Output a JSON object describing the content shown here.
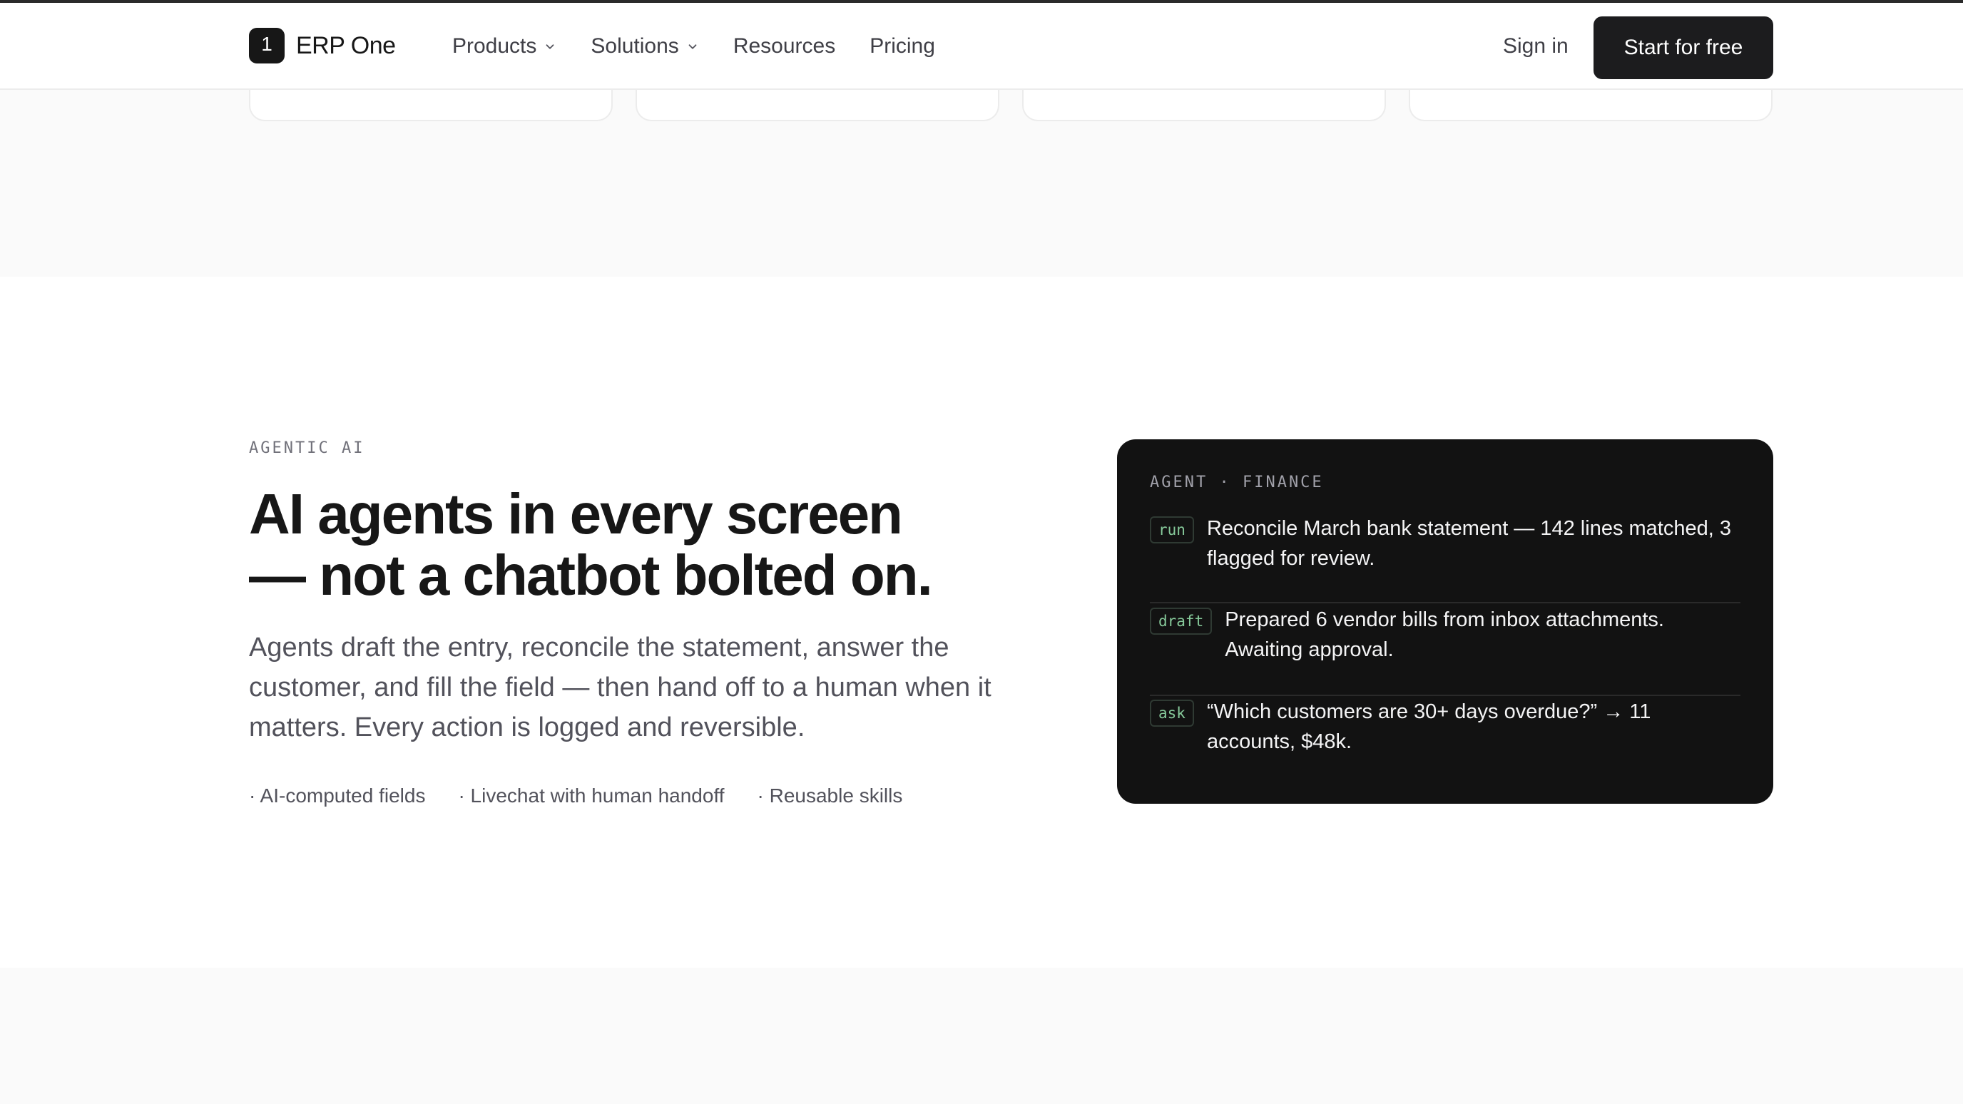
{
  "header": {
    "logo_mark": "1",
    "logo_text": "ERP One",
    "nav": [
      {
        "label": "Products",
        "has_dropdown": true
      },
      {
        "label": "Solutions",
        "has_dropdown": true
      },
      {
        "label": "Resources",
        "has_dropdown": false
      },
      {
        "label": "Pricing",
        "has_dropdown": false
      }
    ],
    "sign_in": "Sign in",
    "cta": "Start for free"
  },
  "agentic": {
    "eyebrow": "AGENTIC AI",
    "headline_line1": "AI agents in every screen",
    "headline_line2": "— not a chatbot bolted on.",
    "lead": "Agents draft the entry, reconcile the statement, answer the customer, and fill the field — then hand off to a human when it matters. Every action is logged and reversible.",
    "features": [
      "· AI-computed fields",
      "· Livechat with human handoff",
      "· Reusable skills"
    ]
  },
  "panel": {
    "title": "AGENT · FINANCE",
    "rows": [
      {
        "tag": "run",
        "text": "Reconcile March bank statement — 142 lines matched, 3 flagged for review."
      },
      {
        "tag": "draft",
        "text": "Prepared 6 vendor bills from inbox attachments. Awaiting approval."
      },
      {
        "tag": "ask",
        "text": "“Which customers are 30+ days overdue?” → 11 accounts, $48k."
      }
    ]
  },
  "colors": {
    "panel_bg": "#121212",
    "tag_green": "#86c99a",
    "cta_bg": "#1c1c1e",
    "section_alt_bg": "#fafafa"
  }
}
